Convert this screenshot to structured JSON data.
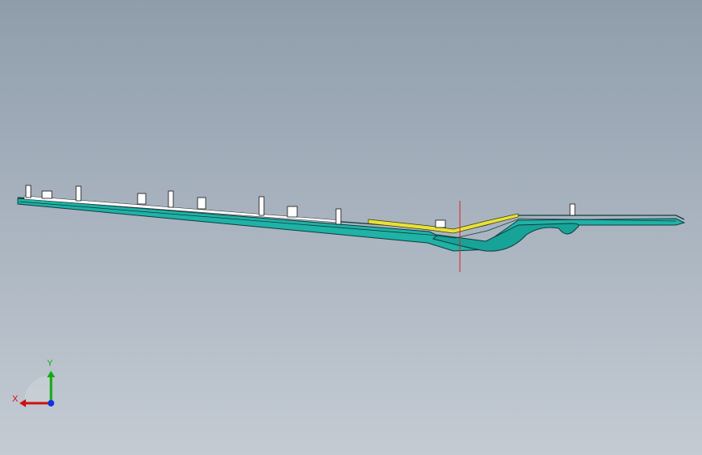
{
  "viewport": {
    "background_top": "#8f9dab",
    "background_bottom": "#c4cbd3"
  },
  "model": {
    "part_color": "#1fb2a6",
    "edge_color": "#0f3b3d",
    "highlight_color": "#e8e23a",
    "clip_color": "#ffffff",
    "origin_marker_color": "#e02020"
  },
  "triad": {
    "x_label": "X",
    "y_label": "Y",
    "x_color": "#cc1111",
    "y_color": "#11aa11",
    "z_color": "#1133dd"
  }
}
